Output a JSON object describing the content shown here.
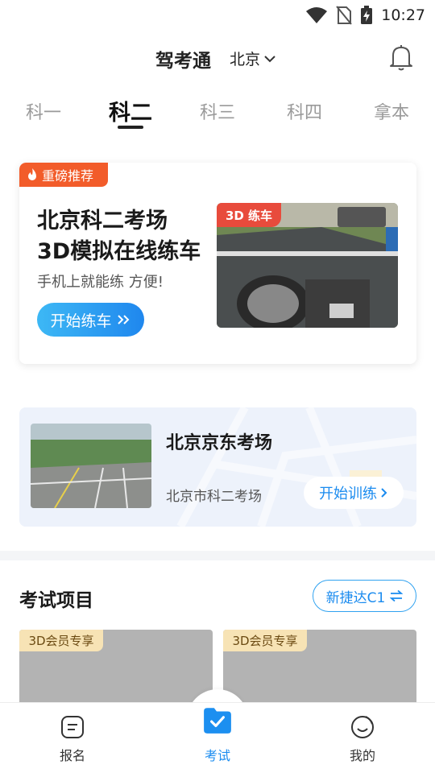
{
  "status_bar": {
    "time": "10:27",
    "icons": [
      "wifi-icon",
      "no-sim-icon",
      "battery-charging-icon"
    ]
  },
  "header": {
    "title": "驾考通",
    "city": "北京",
    "icons": [
      "chevron-down-icon",
      "bell-icon"
    ]
  },
  "tabs": [
    {
      "label": "科一",
      "active": false
    },
    {
      "label": "科二",
      "active": true
    },
    {
      "label": "科三",
      "active": false
    },
    {
      "label": "科四",
      "active": false
    },
    {
      "label": "拿本",
      "active": false
    }
  ],
  "promo": {
    "badge": "重磅推荐",
    "title_line1": "北京科二考场",
    "title_line2": "3D模拟在线练车",
    "subtitle": "手机上就能练 方便!",
    "button": "开始练车",
    "image_tag": "3D 练车",
    "badge_color": "#f25c2a",
    "button_color": "#1f87ee"
  },
  "venue": {
    "name": "北京京东考场",
    "subtitle": "北京市科二考场",
    "button": "开始训练"
  },
  "exam_section": {
    "title": "考试项目",
    "car_model": "新捷达C1",
    "cards": [
      {
        "badge": "3D会员专享"
      },
      {
        "badge": "3D会员专享"
      }
    ]
  },
  "bottom_nav": [
    {
      "label": "报名",
      "icon": "signup-icon",
      "active": false
    },
    {
      "label": "考试",
      "icon": "exam-folder-icon",
      "active": true
    },
    {
      "label": "我的",
      "icon": "profile-face-icon",
      "active": false
    }
  ],
  "colors": {
    "accent": "#1a8bef",
    "vip": "#f7e3b5"
  }
}
